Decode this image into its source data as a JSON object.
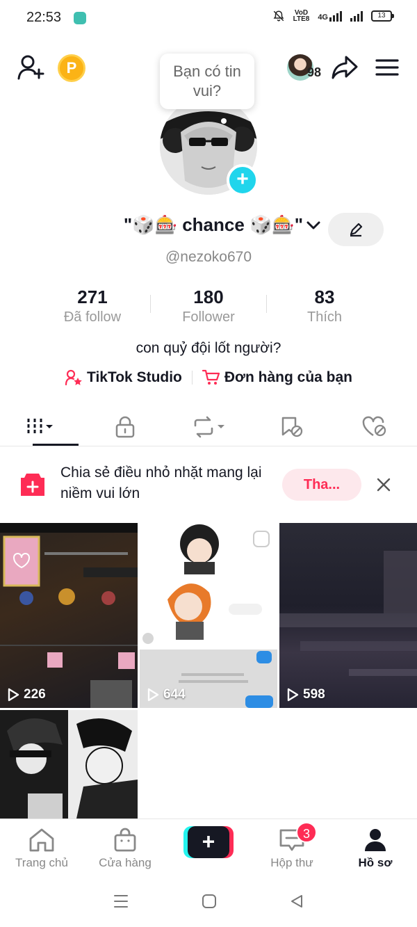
{
  "status_bar": {
    "time": "22:53",
    "volte_top": "VoD",
    "volte_bottom": "LTE8",
    "network": "4G",
    "battery": "13"
  },
  "header": {
    "points_badge": "P",
    "bubble_text": "Bạn có tin vui?",
    "friends_count": "98"
  },
  "profile": {
    "display_name": "\"🎲🎰 chance 🎲🎰\"",
    "username": "@nezoko670",
    "bio": "con quỷ đội lốt người?"
  },
  "stats": [
    {
      "value": "271",
      "label": "Đã follow"
    },
    {
      "value": "180",
      "label": "Follower"
    },
    {
      "value": "83",
      "label": "Thích"
    }
  ],
  "links": {
    "studio": "TikTok Studio",
    "orders": "Đơn hàng của bạn"
  },
  "promo": {
    "text": "Chia sẻ điều nhỏ nhặt mang lại niềm vui lớn",
    "button": "Tha..."
  },
  "videos": [
    {
      "views": "226"
    },
    {
      "views": "644"
    },
    {
      "views": "598"
    }
  ],
  "bottom_nav": {
    "home": "Trang chủ",
    "shop": "Cửa hàng",
    "inbox": "Hộp thư",
    "inbox_badge": "3",
    "profile": "Hồ sơ"
  },
  "colors": {
    "accent": "#fe2c55",
    "cyan": "#25f4ee",
    "text": "#161823",
    "muted": "#999999"
  }
}
